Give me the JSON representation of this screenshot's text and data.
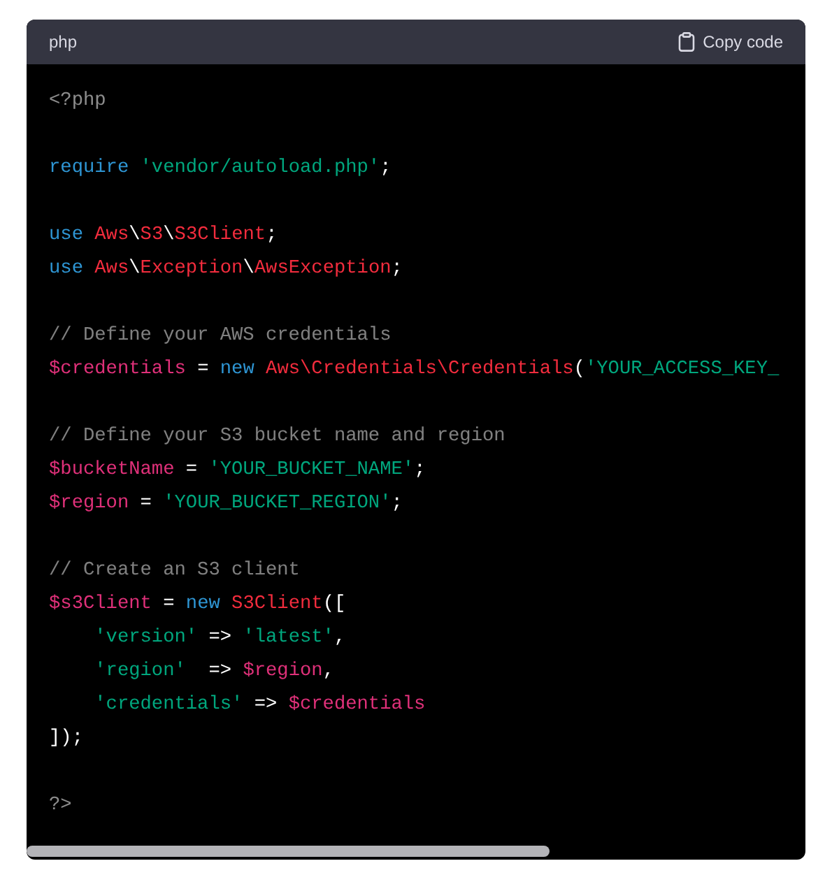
{
  "code_block": {
    "language": "php",
    "copy_button": "Copy code",
    "lines": [
      {
        "kind": "code",
        "tokens": [
          {
            "kind": "meta",
            "text": "<?php"
          }
        ]
      },
      {
        "kind": "blank"
      },
      {
        "kind": "code",
        "tokens": [
          {
            "kind": "keyword",
            "text": "require "
          },
          {
            "kind": "string",
            "text": "'vendor/autoload.php'"
          },
          {
            "kind": "plain",
            "text": ";"
          }
        ]
      },
      {
        "kind": "blank"
      },
      {
        "kind": "code",
        "tokens": [
          {
            "kind": "keyword",
            "text": "use "
          },
          {
            "kind": "class",
            "text": "Aws"
          },
          {
            "kind": "plain",
            "text": "\\"
          },
          {
            "kind": "class",
            "text": "S3"
          },
          {
            "kind": "plain",
            "text": "\\"
          },
          {
            "kind": "class",
            "text": "S3Client"
          },
          {
            "kind": "plain",
            "text": ";"
          }
        ]
      },
      {
        "kind": "code",
        "tokens": [
          {
            "kind": "keyword",
            "text": "use "
          },
          {
            "kind": "class",
            "text": "Aws"
          },
          {
            "kind": "plain",
            "text": "\\"
          },
          {
            "kind": "class",
            "text": "Exception"
          },
          {
            "kind": "plain",
            "text": "\\"
          },
          {
            "kind": "class",
            "text": "AwsException"
          },
          {
            "kind": "plain",
            "text": ";"
          }
        ]
      },
      {
        "kind": "blank"
      },
      {
        "kind": "code",
        "tokens": [
          {
            "kind": "comment",
            "text": "// Define your AWS credentials"
          }
        ]
      },
      {
        "kind": "code",
        "tokens": [
          {
            "kind": "variable",
            "text": "$credentials"
          },
          {
            "kind": "plain",
            "text": " = "
          },
          {
            "kind": "keyword",
            "text": "new "
          },
          {
            "kind": "class",
            "text": "Aws\\Credentials\\Credentials"
          },
          {
            "kind": "plain",
            "text": "("
          },
          {
            "kind": "string",
            "text": "'YOUR_ACCESS_KEY_"
          }
        ]
      },
      {
        "kind": "blank"
      },
      {
        "kind": "code",
        "tokens": [
          {
            "kind": "comment",
            "text": "// Define your S3 bucket name and region"
          }
        ]
      },
      {
        "kind": "code",
        "tokens": [
          {
            "kind": "variable",
            "text": "$bucketName"
          },
          {
            "kind": "plain",
            "text": " = "
          },
          {
            "kind": "string",
            "text": "'YOUR_BUCKET_NAME'"
          },
          {
            "kind": "plain",
            "text": ";"
          }
        ]
      },
      {
        "kind": "code",
        "tokens": [
          {
            "kind": "variable",
            "text": "$region"
          },
          {
            "kind": "plain",
            "text": " = "
          },
          {
            "kind": "string",
            "text": "'YOUR_BUCKET_REGION'"
          },
          {
            "kind": "plain",
            "text": ";"
          }
        ]
      },
      {
        "kind": "blank"
      },
      {
        "kind": "code",
        "tokens": [
          {
            "kind": "comment",
            "text": "// Create an S3 client"
          }
        ]
      },
      {
        "kind": "code",
        "tokens": [
          {
            "kind": "variable",
            "text": "$s3Client"
          },
          {
            "kind": "plain",
            "text": " = "
          },
          {
            "kind": "keyword",
            "text": "new "
          },
          {
            "kind": "class",
            "text": "S3Client"
          },
          {
            "kind": "plain",
            "text": "(["
          }
        ]
      },
      {
        "kind": "code",
        "tokens": [
          {
            "kind": "string",
            "text": "    'version'"
          },
          {
            "kind": "plain",
            "text": " => "
          },
          {
            "kind": "string",
            "text": "'latest'"
          },
          {
            "kind": "plain",
            "text": ","
          }
        ]
      },
      {
        "kind": "code",
        "tokens": [
          {
            "kind": "string",
            "text": "    'region'"
          },
          {
            "kind": "plain",
            "text": "  => "
          },
          {
            "kind": "variable",
            "text": "$region"
          },
          {
            "kind": "plain",
            "text": ","
          }
        ]
      },
      {
        "kind": "code",
        "tokens": [
          {
            "kind": "string",
            "text": "    'credentials'"
          },
          {
            "kind": "plain",
            "text": " => "
          },
          {
            "kind": "variable",
            "text": "$credentials"
          }
        ]
      },
      {
        "kind": "code",
        "tokens": [
          {
            "kind": "plain",
            "text": "]);"
          }
        ]
      },
      {
        "kind": "blank"
      },
      {
        "kind": "code",
        "tokens": [
          {
            "kind": "meta",
            "text": "?>"
          }
        ]
      }
    ]
  }
}
